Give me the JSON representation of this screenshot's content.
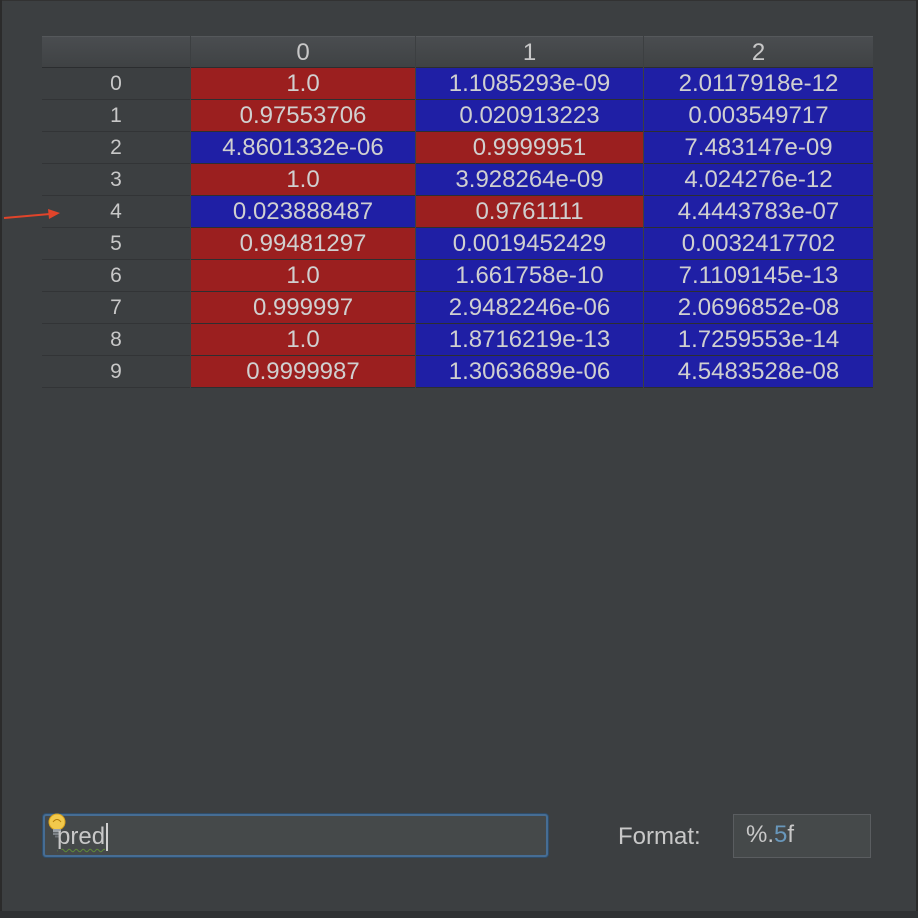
{
  "table": {
    "columns": [
      "0",
      "1",
      "2"
    ],
    "rows": [
      {
        "label": "0",
        "cells": [
          {
            "v": "1.0",
            "c": "hi"
          },
          {
            "v": "1.1085293e-09",
            "c": "lo"
          },
          {
            "v": "2.0117918e-12",
            "c": "lo"
          }
        ]
      },
      {
        "label": "1",
        "cells": [
          {
            "v": "0.97553706",
            "c": "hi"
          },
          {
            "v": "0.020913223",
            "c": "lo"
          },
          {
            "v": "0.003549717",
            "c": "lo"
          }
        ]
      },
      {
        "label": "2",
        "cells": [
          {
            "v": "4.8601332e-06",
            "c": "lo"
          },
          {
            "v": "0.9999951",
            "c": "hi"
          },
          {
            "v": "7.483147e-09",
            "c": "lo"
          }
        ]
      },
      {
        "label": "3",
        "cells": [
          {
            "v": "1.0",
            "c": "hi"
          },
          {
            "v": "3.928264e-09",
            "c": "lo"
          },
          {
            "v": "4.024276e-12",
            "c": "lo"
          }
        ]
      },
      {
        "label": "4",
        "cells": [
          {
            "v": "0.023888487",
            "c": "lo"
          },
          {
            "v": "0.9761111",
            "c": "hi"
          },
          {
            "v": "4.4443783e-07",
            "c": "lo"
          }
        ]
      },
      {
        "label": "5",
        "cells": [
          {
            "v": "0.99481297",
            "c": "hi"
          },
          {
            "v": "0.0019452429",
            "c": "lo"
          },
          {
            "v": "0.0032417702",
            "c": "lo"
          }
        ]
      },
      {
        "label": "6",
        "cells": [
          {
            "v": "1.0",
            "c": "hi"
          },
          {
            "v": "1.661758e-10",
            "c": "lo"
          },
          {
            "v": "7.1109145e-13",
            "c": "lo"
          }
        ]
      },
      {
        "label": "7",
        "cells": [
          {
            "v": "0.999997",
            "c": "hi"
          },
          {
            "v": "2.9482246e-06",
            "c": "lo"
          },
          {
            "v": "2.0696852e-08",
            "c": "lo"
          }
        ]
      },
      {
        "label": "8",
        "cells": [
          {
            "v": "1.0",
            "c": "hi"
          },
          {
            "v": "1.8716219e-13",
            "c": "lo"
          },
          {
            "v": "1.7259553e-14",
            "c": "lo"
          }
        ]
      },
      {
        "label": "9",
        "cells": [
          {
            "v": "0.9999987",
            "c": "hi"
          },
          {
            "v": "1.3063689e-06",
            "c": "lo"
          },
          {
            "v": "4.5483528e-08",
            "c": "lo"
          }
        ]
      }
    ]
  },
  "colors": {
    "high_cell": "#9b1f1f",
    "low_cell": "#1f1fa5",
    "arrow": "#e0442a",
    "focus_border": "#466d94"
  },
  "expression": {
    "value": "pred",
    "icon": "lightbulb-icon"
  },
  "format": {
    "label": "Format:",
    "value_prefix": "%.",
    "value_number": "5",
    "value_suffix": "f"
  },
  "annotation": {
    "icon": "arrow-right-icon"
  }
}
